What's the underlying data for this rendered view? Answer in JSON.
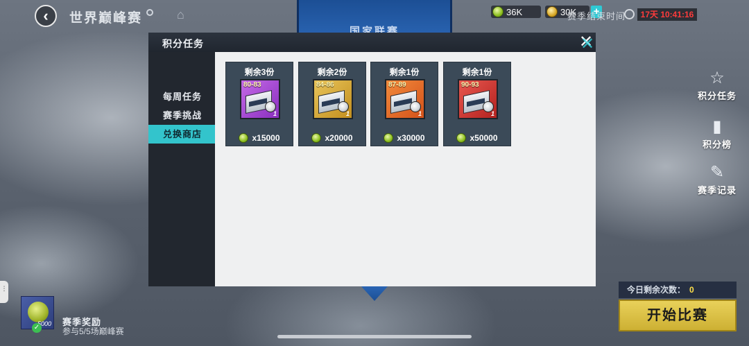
{
  "header": {
    "title": "世界巅峰赛",
    "currencies": [
      {
        "icon": "green-coin-icon",
        "value": "36K"
      },
      {
        "icon": "gold-coin-icon",
        "value": "30K"
      }
    ],
    "plus": "+",
    "season_end_label": "赛季结束时间",
    "timer": "17天 10:41:16"
  },
  "background": {
    "banner_text": "国家联赛"
  },
  "side_menu": [
    {
      "label": "积分任务",
      "icon": "star-badge-icon"
    },
    {
      "label": "积分榜",
      "icon": "leaderboard-icon"
    },
    {
      "label": "赛季记录",
      "icon": "edit-record-icon"
    }
  ],
  "modal": {
    "title": "积分任务",
    "tabs": [
      {
        "label": "每周任务",
        "active": false
      },
      {
        "label": "赛季挑战",
        "active": false
      },
      {
        "label": "兑换商店",
        "active": true
      }
    ],
    "shop_items": [
      {
        "remaining": "剩余3份",
        "range": "80-83",
        "qty": "1",
        "color": "purple",
        "price": "x15000"
      },
      {
        "remaining": "剩余2份",
        "range": "84-86",
        "qty": "1",
        "color": "gold",
        "price": "x20000"
      },
      {
        "remaining": "剩余1份",
        "range": "87-89",
        "qty": "1",
        "color": "orange",
        "price": "x30000"
      },
      {
        "remaining": "剩余1份",
        "range": "90-93",
        "qty": "1",
        "color": "red",
        "price": "x50000"
      }
    ]
  },
  "bottom_left": {
    "reward_points": "5000",
    "title": "赛季奖励",
    "subtitle": "参与5/5场巅峰赛"
  },
  "bottom_right": {
    "remaining_label": "今日剩余次数：",
    "remaining_value": "0",
    "start_button": "开始比赛"
  }
}
